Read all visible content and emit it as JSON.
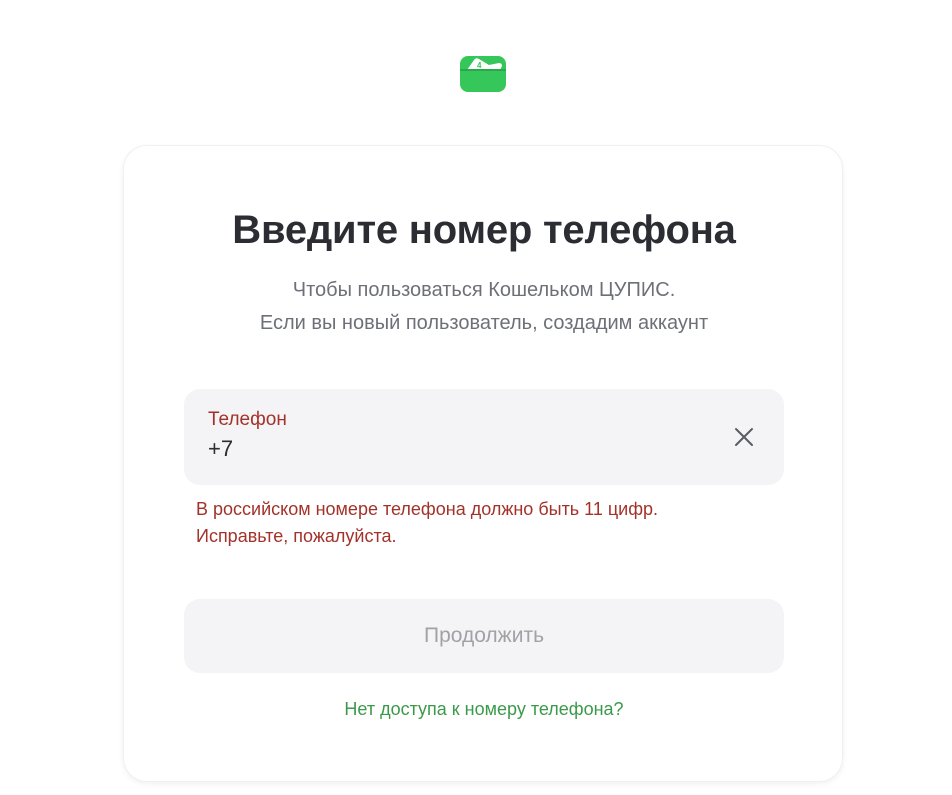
{
  "brand": {
    "logo_icon": "wallet-icon",
    "accent_color": "#35c759"
  },
  "card": {
    "title": "Введите номер телефона",
    "subtitle_line1": "Чтобы пользоваться Кошельком ЦУПИС.",
    "subtitle_line2": "Если вы новый пользователь, создадим аккаунт"
  },
  "phone_input": {
    "label": "Телефон",
    "value": "+7",
    "clear_icon": "close-icon"
  },
  "error": {
    "line1": "В российском номере телефона должно быть 11 цифр.",
    "line2": "Исправьте, пожалуйста.",
    "color": "#a3322a"
  },
  "actions": {
    "continue_label": "Продолжить",
    "continue_disabled": true,
    "no_access_link": "Нет доступа к номеру телефона?",
    "link_color": "#3a9a4a"
  }
}
